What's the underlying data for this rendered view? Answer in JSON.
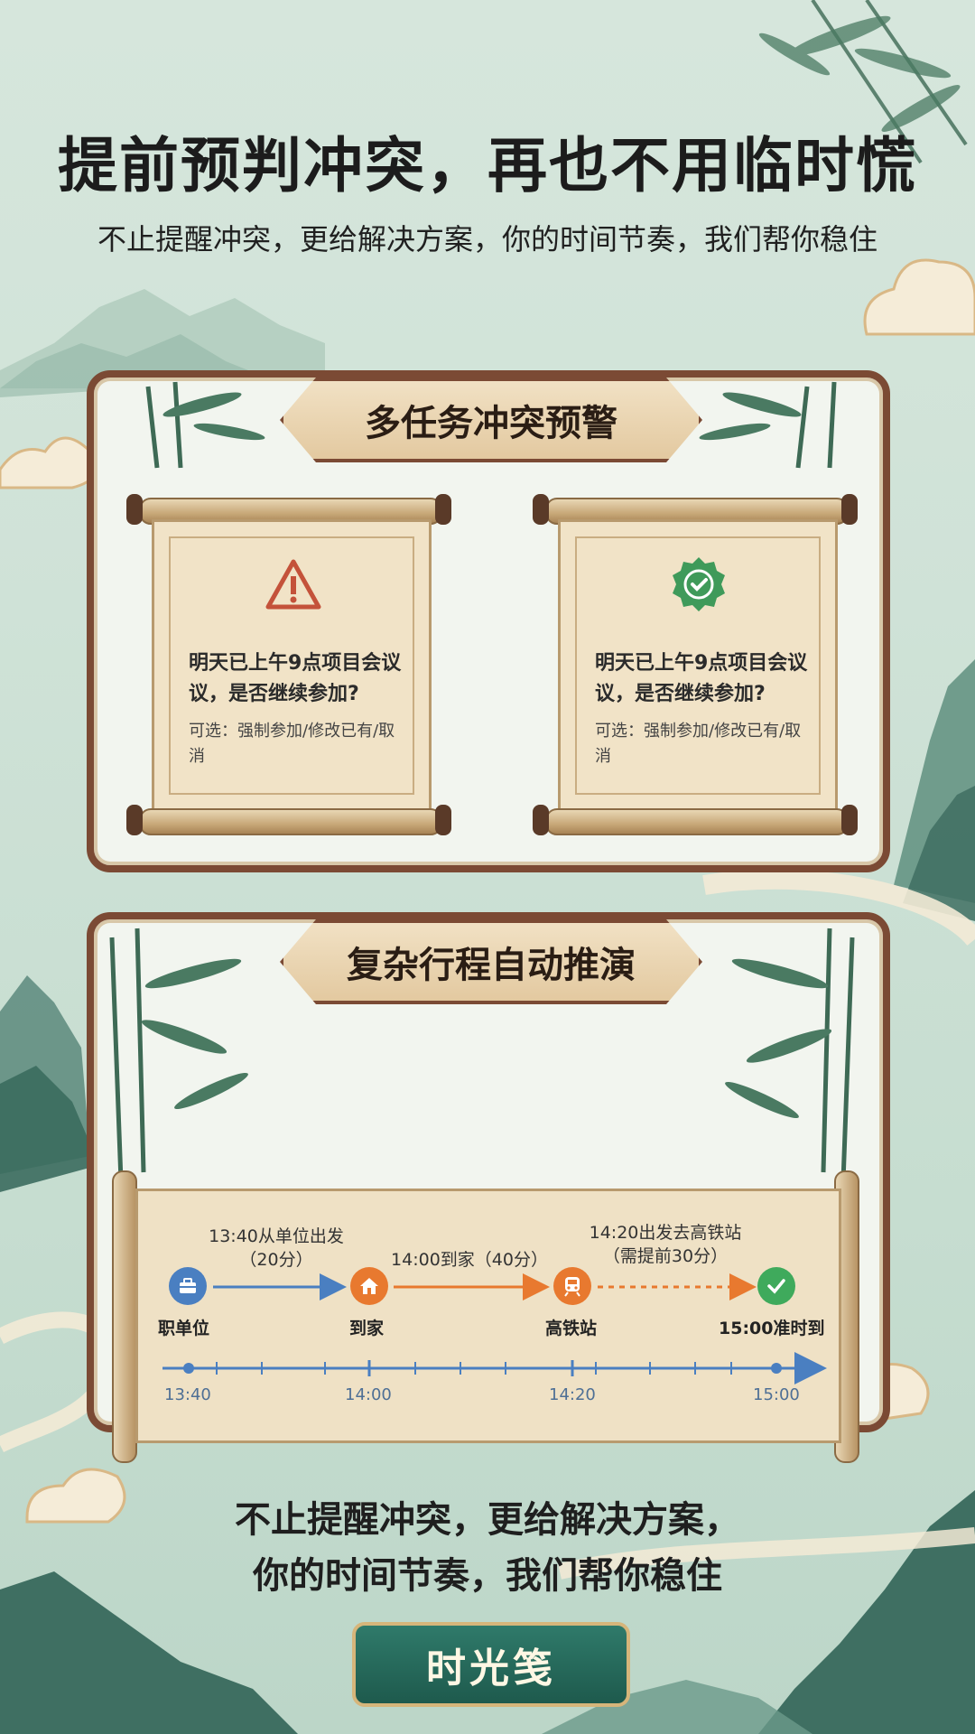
{
  "header": {
    "title": "提前预判冲突，再也不用临时慌",
    "subtitle": "不止提醒冲突，更给解决方案，你的时间节奏，我们帮你稳住"
  },
  "conflict_panel": {
    "title": "多任务冲突预警",
    "cards": [
      {
        "icon": "warning-triangle-icon",
        "question": "明天已上午9点项目会议议，是否继续参加?",
        "options": "可选：强制参加/修改已有/取消"
      },
      {
        "icon": "check-badge-icon",
        "question": "明天已上午9点项目会议议，是否继续参加?",
        "options": "可选：强制参加/修改已有/取消"
      }
    ]
  },
  "itinerary_panel": {
    "title": "复杂行程自动推演",
    "nodes": [
      {
        "label": "职单位",
        "icon": "briefcase-icon"
      },
      {
        "label": "到家",
        "icon": "home-icon"
      },
      {
        "label": "高铁站",
        "icon": "train-icon"
      },
      {
        "label": "15:00准时到",
        "icon": "check-icon"
      }
    ],
    "legs": [
      {
        "line1": "13:40从单位出发",
        "line2": "（20分）"
      },
      {
        "line1": "14:00到家（40分）",
        "line2": ""
      },
      {
        "line1": "14:20出发去高铁站",
        "line2": "（需提前30分）"
      }
    ],
    "ticks": [
      "13:40",
      "14:00",
      "14:20",
      "15:00"
    ]
  },
  "footer": {
    "line1": "不止提醒冲突，更给解决方案，",
    "line2": "你的时间节奏，我们帮你稳住",
    "brand": "时光笺"
  },
  "colors": {
    "frame_brown": "#7b4a34",
    "warning_red": "#c4523a",
    "success_green": "#3f9a5a",
    "node_blue": "#4a7fc1",
    "node_orange": "#e8792f",
    "node_green": "#3faa5c",
    "brand_teal": "#1e5a4d"
  }
}
